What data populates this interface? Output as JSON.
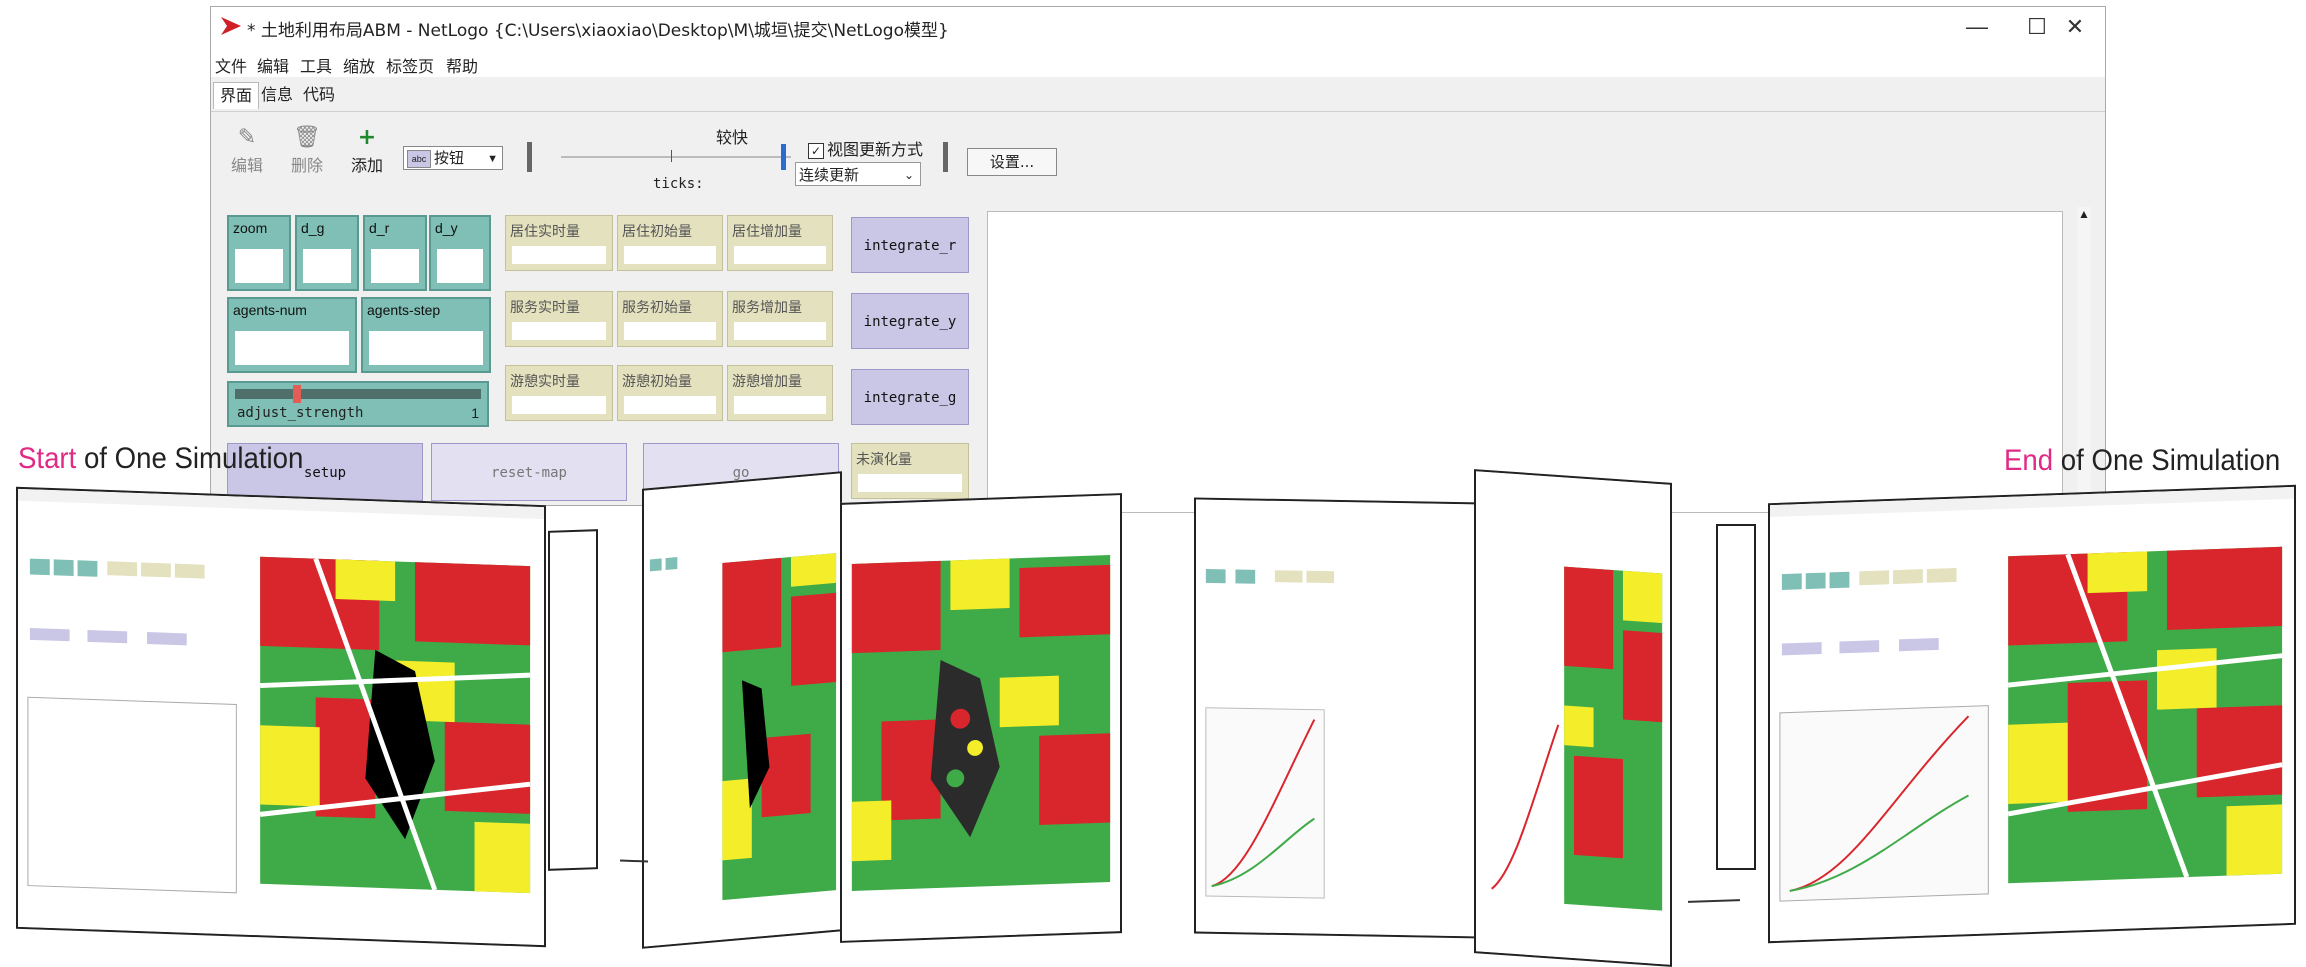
{
  "window": {
    "title": "* 土地利用布局ABM - NetLogo {C:\\Users\\xiaoxiao\\Desktop\\M\\城垣\\提交\\NetLogo模型}",
    "controls": {
      "minimize": "—",
      "maximize": "☐",
      "close": "✕"
    }
  },
  "menu": [
    "文件",
    "编辑",
    "工具",
    "缩放",
    "标签页",
    "帮助"
  ],
  "tabs": [
    "界面",
    "信息",
    "代码"
  ],
  "toolbar": {
    "edit": "编辑",
    "delete": "删除",
    "add": "添加",
    "widget_type": "按钮",
    "speed_label": "较快",
    "ticks_label": "ticks:",
    "update_checkbox": "视图更新方式",
    "update_mode": "连续更新",
    "settings": "设置..."
  },
  "inputs": [
    {
      "label": "zoom"
    },
    {
      "label": "d_g"
    },
    {
      "label": "d_r"
    },
    {
      "label": "d_y"
    },
    {
      "label": "agents-num"
    },
    {
      "label": "agents-step"
    }
  ],
  "slider": {
    "label": "adjust_strength",
    "value": "1",
    "fraction": 0.25
  },
  "monitors": [
    [
      "居住实时量",
      "居住初始量",
      "居住增加量"
    ],
    [
      "服务实时量",
      "服务初始量",
      "服务增加量"
    ],
    [
      "游憩实时量",
      "游憩初始量",
      "游憩增加量"
    ]
  ],
  "integrate_buttons": [
    "integrate_r",
    "integrate_y",
    "integrate_g"
  ],
  "bottom_buttons": [
    "setup",
    "reset-map",
    "go"
  ],
  "unchanged_monitor": "未演化量",
  "captions": {
    "start_highlight": "Start",
    "start_rest": " of One Simulation",
    "end_highlight": "End",
    "end_rest": " of One Simulation"
  },
  "colors": {
    "input_teal": "#7fbfb5",
    "monitor_khaki": "#e3e1be",
    "button_lavender": "#c9c6e6",
    "map_red": "#d9262c",
    "map_green": "#3eab48",
    "map_yellow": "#f3ed2a",
    "highlight_pink": "#e02a86"
  }
}
